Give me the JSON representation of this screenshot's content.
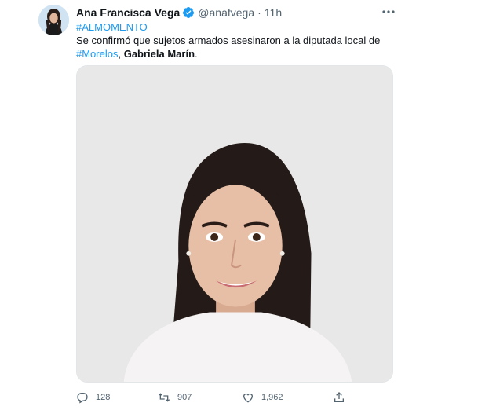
{
  "author": {
    "display_name": "Ana Francisca Vega",
    "handle": "@anafvega",
    "separator": "·",
    "time": "11h",
    "verified": true,
    "avatar_icon": "profile-photo"
  },
  "tweet": {
    "hashtag_top": "#ALMOMENTO",
    "line1": "Se confirmó que sujetos armados asesinaron a la diputada local de",
    "hashtag_inline": "#Morelos",
    "comma": ",",
    "bold_name": "Gabriela Marín",
    "period": "."
  },
  "media": {
    "kind": "portrait-photo"
  },
  "actions": {
    "reply_count": "128",
    "retweet_count": "907",
    "like_count": "1,962"
  },
  "colors": {
    "link": "#1d9bf0",
    "verified": "#1d9bf0",
    "muted": "#536471",
    "text": "#0f1419"
  }
}
